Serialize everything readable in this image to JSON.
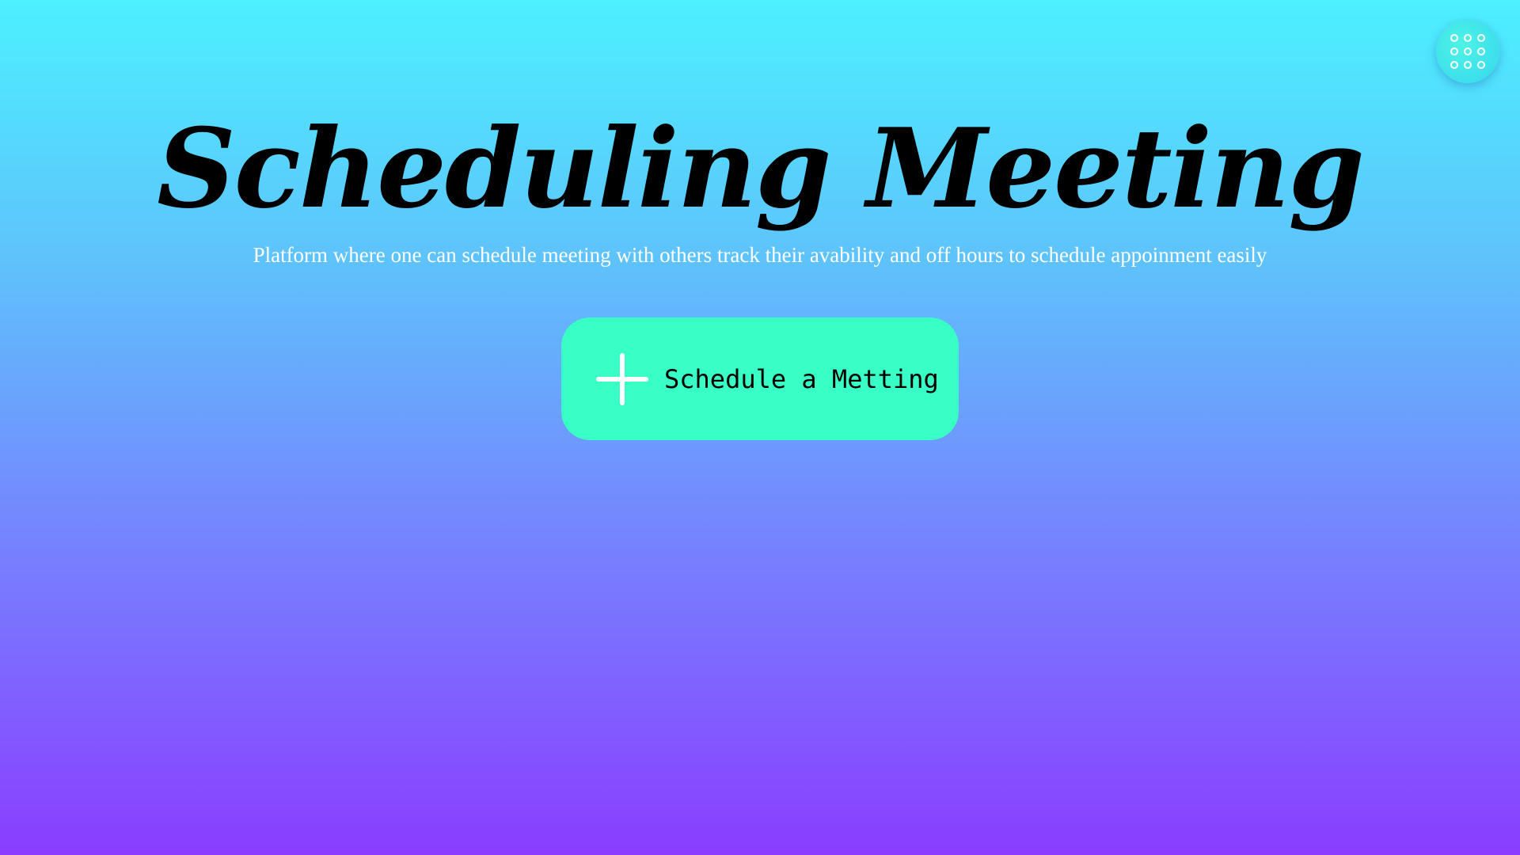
{
  "header": {
    "title": "Scheduling Meeting",
    "subtitle": "Platform where one can schedule meeting with others track their avability and off hours to schedule appoinment easily"
  },
  "menu": {
    "icon": "grid-menu-icon"
  },
  "actions": {
    "schedule_label": "Schedule a Metting",
    "schedule_icon": "plus-icon"
  },
  "colors": {
    "gradient_top": "#4cf0ff",
    "gradient_bottom": "#8a3dff",
    "button_bg": "#38ffc5",
    "title_color": "#000000",
    "subtitle_color": "#ffffff"
  }
}
